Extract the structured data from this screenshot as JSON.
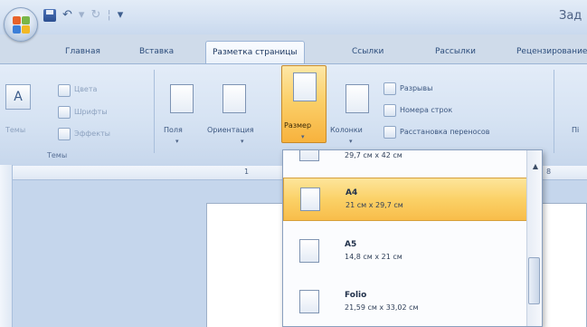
{
  "window": {
    "title": "Зад"
  },
  "quick_access": {
    "icons": [
      "save-icon",
      "undo-icon",
      "redo-icon",
      "customize-icon"
    ]
  },
  "tabs": [
    {
      "label": "Главная",
      "active": false
    },
    {
      "label": "Вставка",
      "active": false
    },
    {
      "label": "Разметка страницы",
      "active": true
    },
    {
      "label": "Ссылки",
      "active": false
    },
    {
      "label": "Рассылки",
      "active": false
    },
    {
      "label": "Рецензирование",
      "active": false
    }
  ],
  "ribbon": {
    "themes_group": {
      "caption": "Темы",
      "themes_button": "Темы",
      "colors": "Цвета",
      "fonts": "Шрифты",
      "effects": "Эффекты"
    },
    "page_setup": {
      "margins": "Поля",
      "orientation": "Ориентация",
      "size": "Размер",
      "columns": "Колонки",
      "breaks": "Разрывы",
      "line_numbers": "Номера строк",
      "hyphenation": "Расстановка переносов"
    },
    "cut_label": "Пі"
  },
  "ruler": {
    "numbers": [
      "1",
      "8"
    ]
  },
  "size_dropdown": {
    "items": [
      {
        "name": "",
        "dims": "29,7 см x 42 см",
        "selected": false
      },
      {
        "name": "A4",
        "dims": "21 см x 29,7 см",
        "selected": true
      },
      {
        "name": "A5",
        "dims": "14,8 см x 21 см",
        "selected": false
      },
      {
        "name": "Folio",
        "dims": "21,59 см x 33,02 см",
        "selected": false
      }
    ]
  },
  "colors": {
    "accent": "#fbd167",
    "ribbon": "#d6e3f3",
    "text": "#1e395b"
  }
}
